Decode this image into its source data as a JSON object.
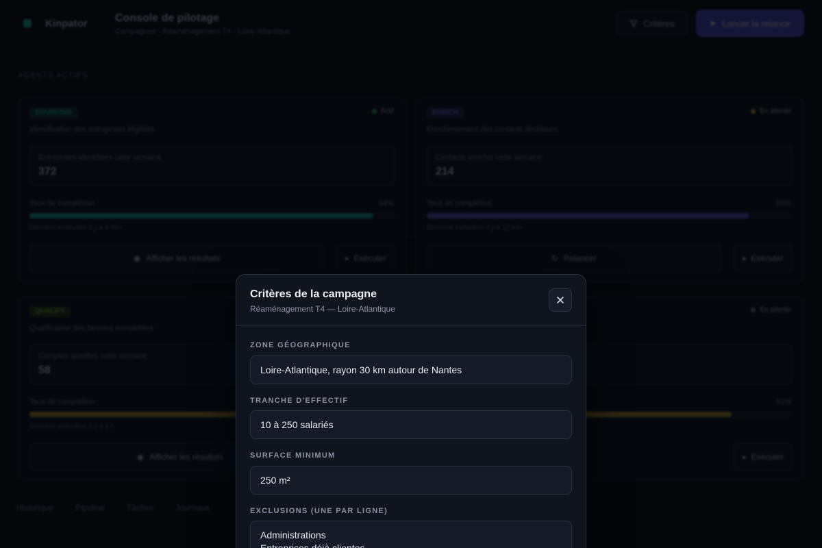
{
  "app": {
    "brand": "Kinpator",
    "page_title": "Console de pilotage",
    "page_subtitle": "Campagnes · Réaménagement T4 · Loire-Atlantique",
    "secondary_button": "Critères",
    "primary_button": "Lancer la relance"
  },
  "section_label": "AGENTS ACTIFS",
  "cards": [
    {
      "tag": "SOURCING",
      "tag_color": "#1fd1b2",
      "status": "Actif",
      "status_color": "#22c55e",
      "description": "Identification des entreprises éligibles",
      "metric_label": "Entreprises identifiées cette semaine",
      "metric_value": "372",
      "bar_label": "Taux de complétion",
      "bar_pct": "94%",
      "bar_value": 0.94,
      "bar_color": "#17b3a3",
      "bar_note": "Dernière exécution il y a 4 min",
      "action_main": "Afficher les résultats",
      "action_side": "Exécuter"
    },
    {
      "tag": "ENRICH",
      "tag_color": "#7c6cf2",
      "status": "En attente",
      "status_color": "#f5b041",
      "description": "Enrichissement des contacts décideurs",
      "metric_label": "Contacts enrichis cette semaine",
      "metric_value": "214",
      "bar_label": "Taux de complétion",
      "bar_pct": "88%",
      "bar_value": 0.88,
      "bar_color": "#6d5ce8",
      "bar_note": "Dernière exécution il y a 12 min",
      "action_main": "Relancer",
      "action_side": "Exécuter"
    },
    {
      "tag": "QUALIFY",
      "tag_color": "#9acd32",
      "status": "En attente",
      "status_color": "#8892a3",
      "description": "Qualification des besoins immobiliers",
      "metric_label": "Comptes qualifiés cette semaine",
      "metric_value": "58",
      "bar_label": "Taux de complétion",
      "bar_pct": "92%",
      "bar_value": 0.92,
      "bar_color": "#c9a227",
      "bar_note": "Dernière exécution il y a 1 h",
      "action_main": "Afficher les résultats",
      "action_side": "Exécuter"
    }
  ],
  "bottom_tabs": [
    "Historique",
    "Pipeline",
    "Tâches",
    "Journaux"
  ],
  "modal": {
    "title": "Critères de la campagne",
    "subtitle": "Réaménagement T4 — Loire-Atlantique",
    "fields": {
      "zone_label": "ZONE GÉOGRAPHIQUE",
      "zone_value": "Loire-Atlantique, rayon 30 km autour de Nantes",
      "effectif_label": "TRANCHE D'EFFECTIF",
      "effectif_value": "10 à 250 salariés",
      "surface_label": "SURFACE MINIMUM",
      "surface_value": "250 m²",
      "exclusions_label": "EXCLUSIONS (UNE PAR LIGNE)",
      "exclusions_value": "Administrations\nEntreprises déjà clientes"
    }
  }
}
